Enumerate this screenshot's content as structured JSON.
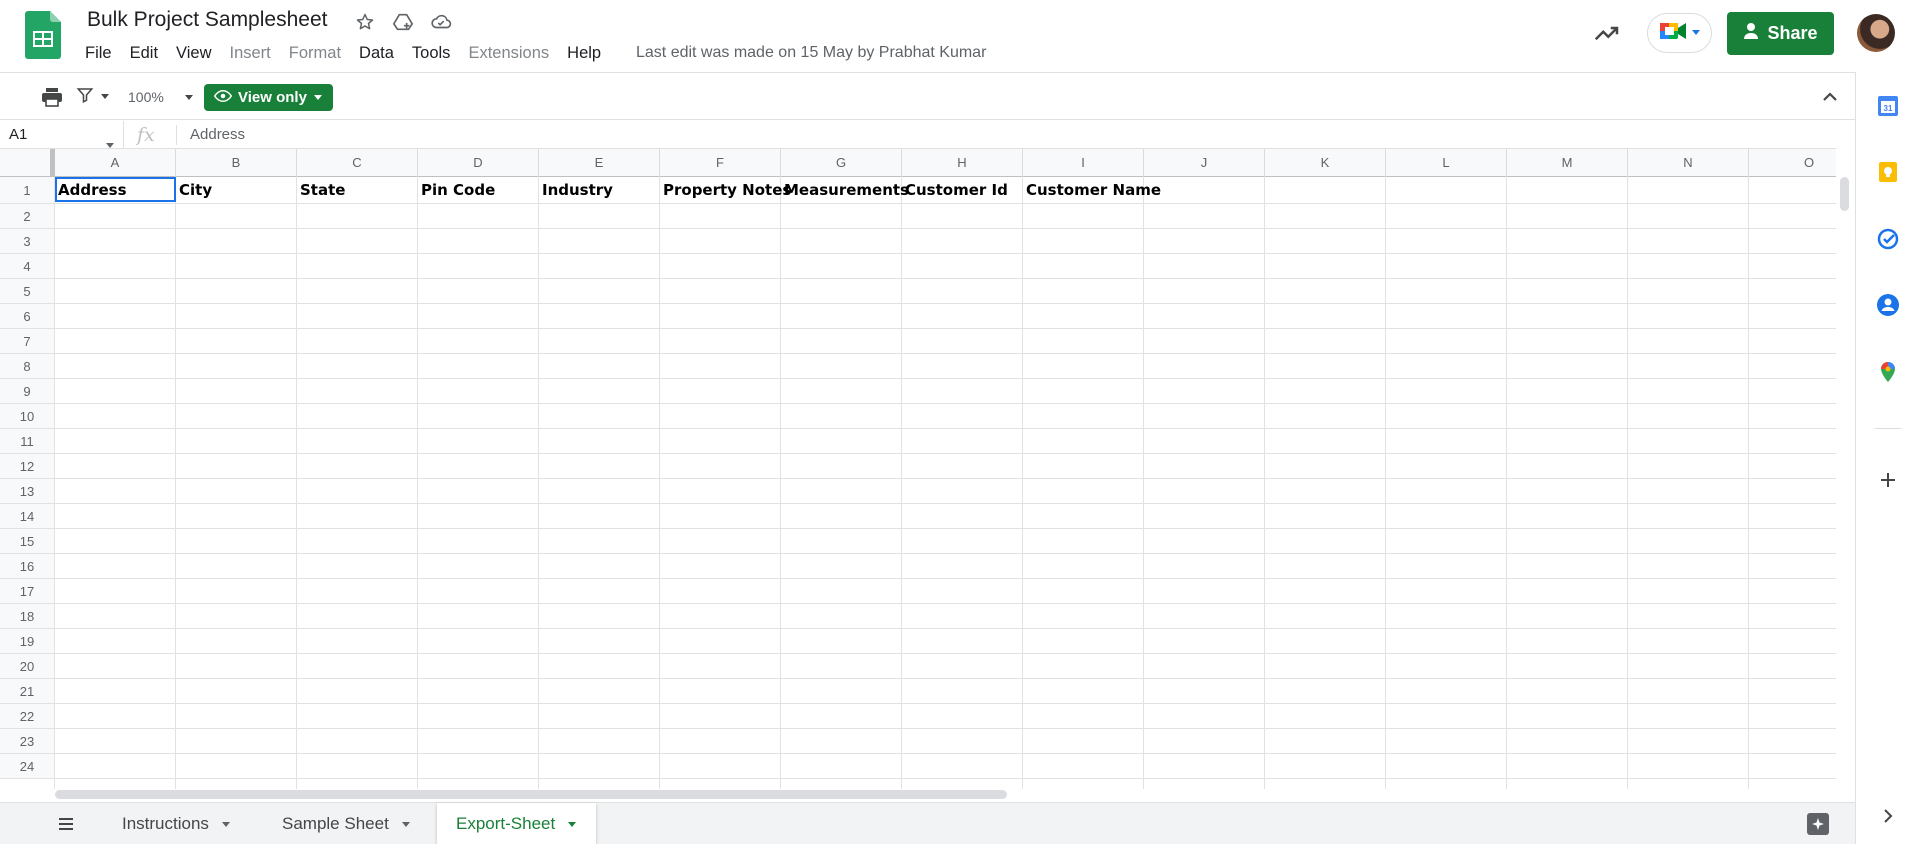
{
  "doc": {
    "title": "Bulk Project Samplesheet",
    "last_edit": "Last edit was made on 15 May by Prabhat Kumar"
  },
  "menu": [
    "File",
    "Edit",
    "View",
    "Insert",
    "Format",
    "Data",
    "Tools",
    "Extensions",
    "Help"
  ],
  "menu_disabled": [
    "Insert",
    "Format",
    "Extensions"
  ],
  "header": {
    "share_label": "Share"
  },
  "toolbar": {
    "zoom": "100%",
    "view_only_label": "View only"
  },
  "formula_bar": {
    "name_box": "A1",
    "fx_symbol": "fx",
    "content": "Address"
  },
  "grid": {
    "columns": [
      "A",
      "B",
      "C",
      "D",
      "E",
      "F",
      "G",
      "H",
      "I",
      "J",
      "K",
      "L",
      "M",
      "N",
      "O"
    ],
    "row_numbers": [
      "1",
      "2",
      "3",
      "4",
      "5",
      "6",
      "7",
      "8",
      "9",
      "10",
      "11",
      "12",
      "13",
      "14",
      "15",
      "16",
      "17",
      "18",
      "19",
      "20",
      "21",
      "22",
      "23",
      "24"
    ],
    "row1": [
      "Address",
      "City",
      "State",
      "Pin Code",
      "Industry",
      "Property Notes",
      "Measurements",
      "Customer Id",
      "Customer Name"
    ],
    "selected_cell": "A1"
  },
  "sheets": [
    {
      "name": "Instructions",
      "active": false
    },
    {
      "name": "Sample Sheet",
      "active": false
    },
    {
      "name": "Export-Sheet",
      "active": true
    }
  ],
  "colors": {
    "brand_green": "#188038",
    "select_blue": "#1a73e8"
  },
  "side_panel_icons": [
    "calendar-icon",
    "keep-icon",
    "tasks-icon",
    "contacts-icon",
    "maps-icon",
    "add-icon",
    "expand-icon"
  ]
}
